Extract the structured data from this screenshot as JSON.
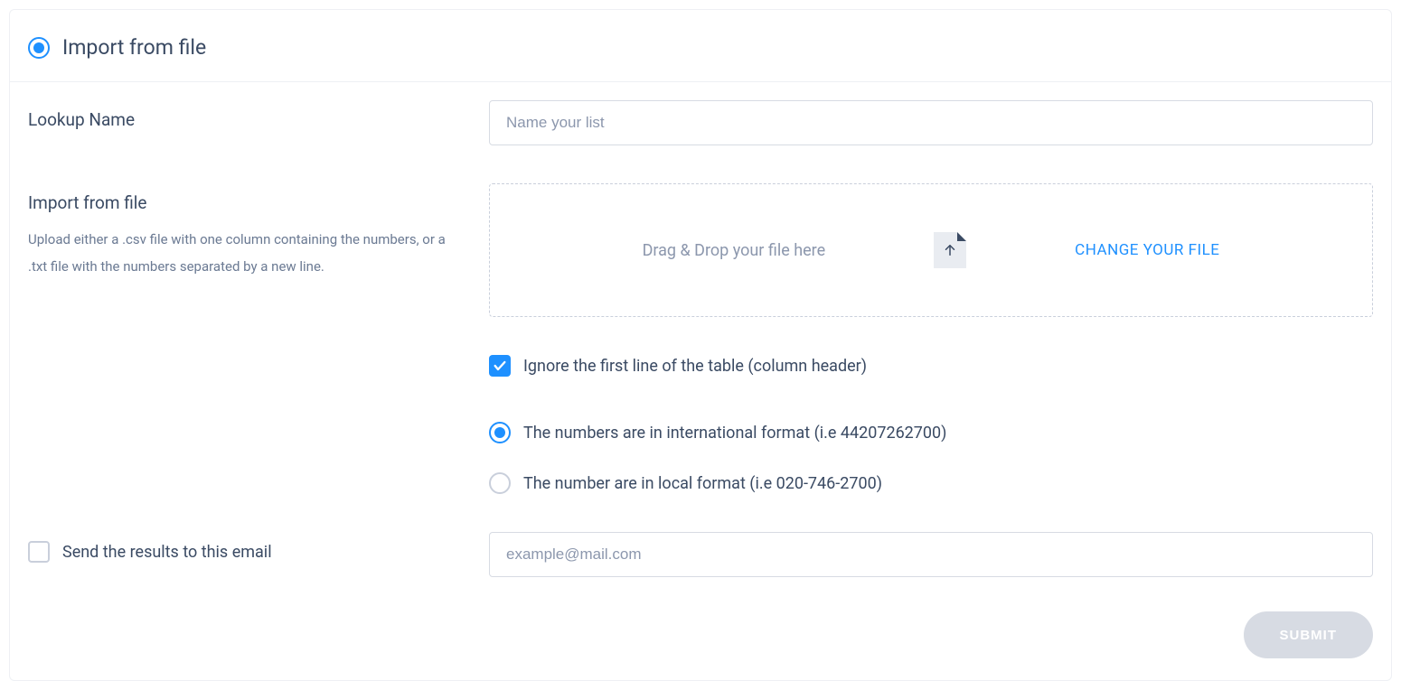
{
  "header": {
    "title": "Import from file"
  },
  "lookup": {
    "label": "Lookup Name",
    "placeholder": "Name your list",
    "value": ""
  },
  "import": {
    "label": "Import from file",
    "help": "Upload either a .csv file with one column containing the numbers, or a .txt file with the numbers separated by a new line.",
    "dropzone_text": "Drag & Drop your file here",
    "change_link": "CHANGE YOUR FILE"
  },
  "options": {
    "ignore_first_line": {
      "checked": true,
      "label": "Ignore the first line of the table (column header)"
    },
    "format_options": [
      {
        "selected": true,
        "label": "The numbers are in international format (i.e 44207262700)"
      },
      {
        "selected": false,
        "label": "The number are in local format (i.e 020-746-2700)"
      }
    ]
  },
  "email": {
    "send_label": "Send the results to this email",
    "send_checked": false,
    "placeholder": "example@mail.com",
    "value": ""
  },
  "actions": {
    "submit": "SUBMIT"
  }
}
